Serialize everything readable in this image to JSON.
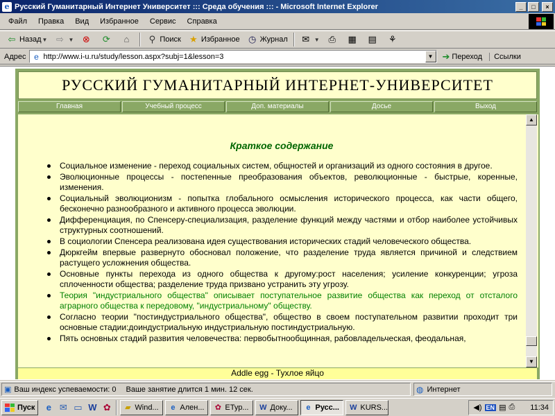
{
  "window": {
    "title": "Русский Гуманитарный Интернет Университет ::: Среда обучения ::: - Microsoft Internet Explorer",
    "icon": "ie-icon",
    "buttons": {
      "minimize": "_",
      "maximize": "□",
      "close": "×"
    }
  },
  "menu": {
    "items": [
      "Файл",
      "Правка",
      "Вид",
      "Избранное",
      "Сервис",
      "Справка"
    ]
  },
  "toolbar": {
    "back": "Назад",
    "search": "Поиск",
    "favorites": "Избранное",
    "history": "Журнал"
  },
  "address": {
    "label": "Адрес",
    "url": "http://www.i-u.ru/study/lesson.aspx?subj=1&lesson=3",
    "go": "Переход",
    "links": "Ссылки"
  },
  "site": {
    "title": "РУССКИЙ ГУМАНИТАРНЫЙ ИНТЕРНЕТ-УНИВЕРСИТЕТ",
    "nav": [
      "Главная",
      "Учебный процесс",
      "Доп. материалы",
      "Досье",
      "Выход"
    ],
    "heading": "Краткое содержание",
    "points": [
      {
        "text": "Социальное изменение - переход социальных систем, общностей и организаций из одного состояния в другое.",
        "highlight": false
      },
      {
        "text": "Эволюционные процессы - постепенные преобразования объектов, революционные - быстрые, коренные, изменения.",
        "highlight": false
      },
      {
        "text": "Социальный эволюционизм - попытка глобального осмысления исторического процесса, как части общего, бесконечно разнообразного и активного процесса эволюции.",
        "highlight": false
      },
      {
        "text": "Дифференциация, по Спенсеру-специализация, разделение функций между частями и отбор наиболее устойчивых структурных соотношений.",
        "highlight": false
      },
      {
        "text": "В социологии Спенсера реализована идея существования исторических стадий человеческого общества.",
        "highlight": false
      },
      {
        "text": "Дюркгейм впервые развернуто обосновал положение, что разделение труда является причиной и следствием растущего усложнения общества.",
        "highlight": false
      },
      {
        "text": "Основные пункты перехода из одного общества к другому:рост населения; усиление конкуренции; угроза сплоченности общества; разделение труда призвано устранить эту угрозу.",
        "highlight": false
      },
      {
        "text": "Теория \"индустриального общества\" описывает поступательное развитие общества как переход от отсталого аграрного общества к передовому, \"индустриальному\" обществу.",
        "highlight": true
      },
      {
        "text": "Согласно теории \"постиндустриального общества\", общество в своем поступательном развитии проходит три основные стадии:доиндустриальную индустриальную постиндустриальную.",
        "highlight": false
      },
      {
        "text": "Пять основных стадий развития человечества: первобытнообщинная, рабовладельческая, феодальная,",
        "highlight": false
      }
    ],
    "footer": "Addle egg - Тухлое яйцо",
    "colors": {
      "frame": "#8aa865",
      "content_bg": "#ffffcc",
      "heading": "#006600",
      "highlight_text": "#008000"
    }
  },
  "status": {
    "progress": "Ваш индекс успеваемости: 0",
    "duration": "Ваше занятие длится 1 мин. 12 сек.",
    "zone": "Интернет"
  },
  "taskbar": {
    "start": "Пуск",
    "tasks": [
      {
        "label": "Wind...",
        "icon": "folder-icon",
        "active": false
      },
      {
        "label": "Ален...",
        "icon": "ie-icon",
        "active": false
      },
      {
        "label": "ЕТур...",
        "icon": "app-icon",
        "active": false
      },
      {
        "label": "Доку...",
        "icon": "word-icon",
        "active": false
      },
      {
        "label": "Русс...",
        "icon": "ie-icon",
        "active": true
      },
      {
        "label": "KURS...",
        "icon": "word-icon",
        "active": false
      }
    ],
    "lang": "EN",
    "time": "11:34"
  }
}
